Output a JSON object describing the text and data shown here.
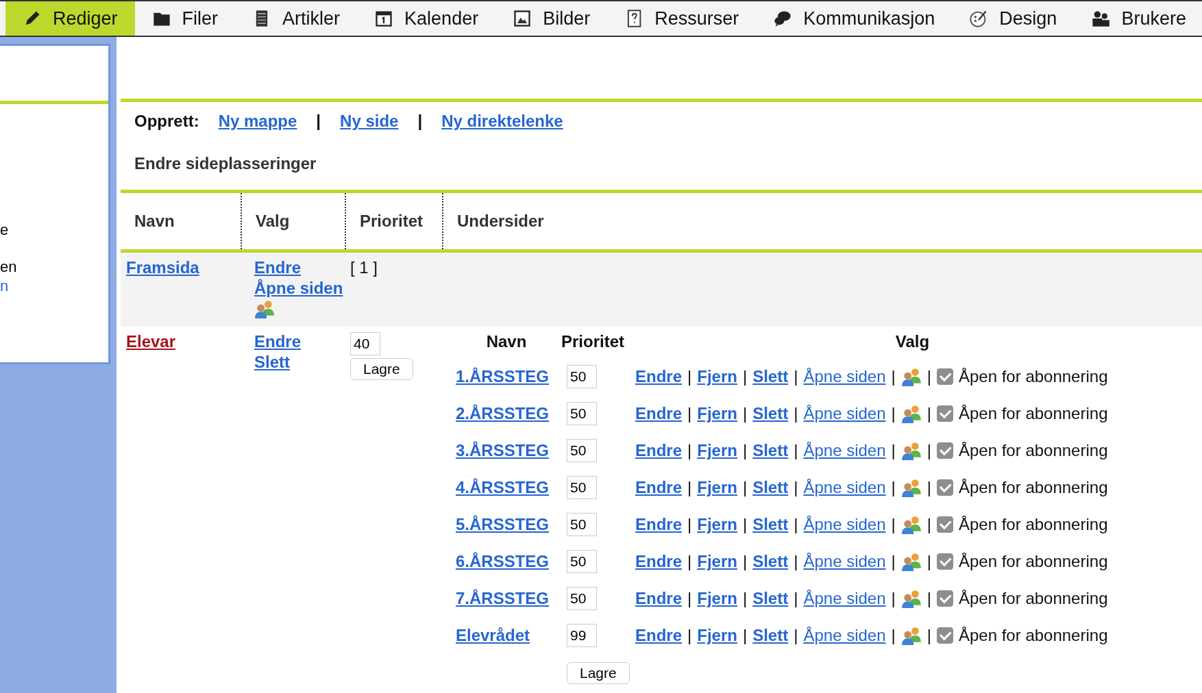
{
  "nav": [
    {
      "label": "Rediger",
      "selected": true
    },
    {
      "label": "Filer",
      "selected": false
    },
    {
      "label": "Artikler",
      "selected": false
    },
    {
      "label": "Kalender",
      "selected": false
    },
    {
      "label": "Bilder",
      "selected": false
    },
    {
      "label": "Ressurser",
      "selected": false
    },
    {
      "label": "Kommunikasjon",
      "selected": false
    },
    {
      "label": "Design",
      "selected": false
    },
    {
      "label": "Brukere",
      "selected": false
    }
  ],
  "sidebar": {
    "texts": [
      {
        "text": "e",
        "kind": "plain"
      },
      {
        "text": "en",
        "kind": "plain"
      },
      {
        "text": "n",
        "kind": "link"
      }
    ]
  },
  "create": {
    "label": "Opprett:",
    "links": [
      "Ny mappe",
      "Ny side",
      "Ny direktelenke"
    ],
    "separator": "|"
  },
  "subtitle": "Endre sideplasseringer",
  "table": {
    "columns": [
      "Navn",
      "Valg",
      "Prioritet",
      "Undersider"
    ],
    "rows": [
      {
        "name": "Framsida",
        "selected": false,
        "options": [
          "Endre",
          "Åpne siden"
        ],
        "users_icon": true,
        "priority_text": "[ 1 ]"
      },
      {
        "name": "Elevar",
        "selected": true,
        "options": [
          "Endre",
          "Slett"
        ],
        "users_icon": false,
        "priority_value": "40",
        "save_button": "Lagre",
        "subpages": {
          "columns": [
            "Navn",
            "Prioritet",
            "Valg"
          ],
          "save_button": "Lagre",
          "separator": "|",
          "rows": [
            {
              "name": "1.ÅRSSTEG",
              "priority": "50",
              "links": [
                "Endre",
                "Fjern",
                "Slett"
              ],
              "open_link": "Åpne siden",
              "subscription": "Åpen for abonnering",
              "checked": true
            },
            {
              "name": "2.ÅRSSTEG",
              "priority": "50",
              "links": [
                "Endre",
                "Fjern",
                "Slett"
              ],
              "open_link": "Åpne siden",
              "subscription": "Åpen for abonnering",
              "checked": true
            },
            {
              "name": "3.ÅRSSTEG",
              "priority": "50",
              "links": [
                "Endre",
                "Fjern",
                "Slett"
              ],
              "open_link": "Åpne siden",
              "subscription": "Åpen for abonnering",
              "checked": true
            },
            {
              "name": "4.ÅRSSTEG",
              "priority": "50",
              "links": [
                "Endre",
                "Fjern",
                "Slett"
              ],
              "open_link": "Åpne siden",
              "subscription": "Åpen for abonnering",
              "checked": true
            },
            {
              "name": "5.ÅRSSTEG",
              "priority": "50",
              "links": [
                "Endre",
                "Fjern",
                "Slett"
              ],
              "open_link": "Åpne siden",
              "subscription": "Åpen for abonnering",
              "checked": true
            },
            {
              "name": "6.ÅRSSTEG",
              "priority": "50",
              "links": [
                "Endre",
                "Fjern",
                "Slett"
              ],
              "open_link": "Åpne siden",
              "subscription": "Åpen for abonnering",
              "checked": true
            },
            {
              "name": "7.ÅRSSTEG",
              "priority": "50",
              "links": [
                "Endre",
                "Fjern",
                "Slett"
              ],
              "open_link": "Åpne siden",
              "subscription": "Åpen for abonnering",
              "checked": true
            },
            {
              "name": "Elevrådet",
              "priority": "99",
              "links": [
                "Endre",
                "Fjern",
                "Slett"
              ],
              "open_link": "Åpne siden",
              "subscription": "Åpen for abonnering",
              "checked": true
            }
          ]
        }
      }
    ]
  }
}
